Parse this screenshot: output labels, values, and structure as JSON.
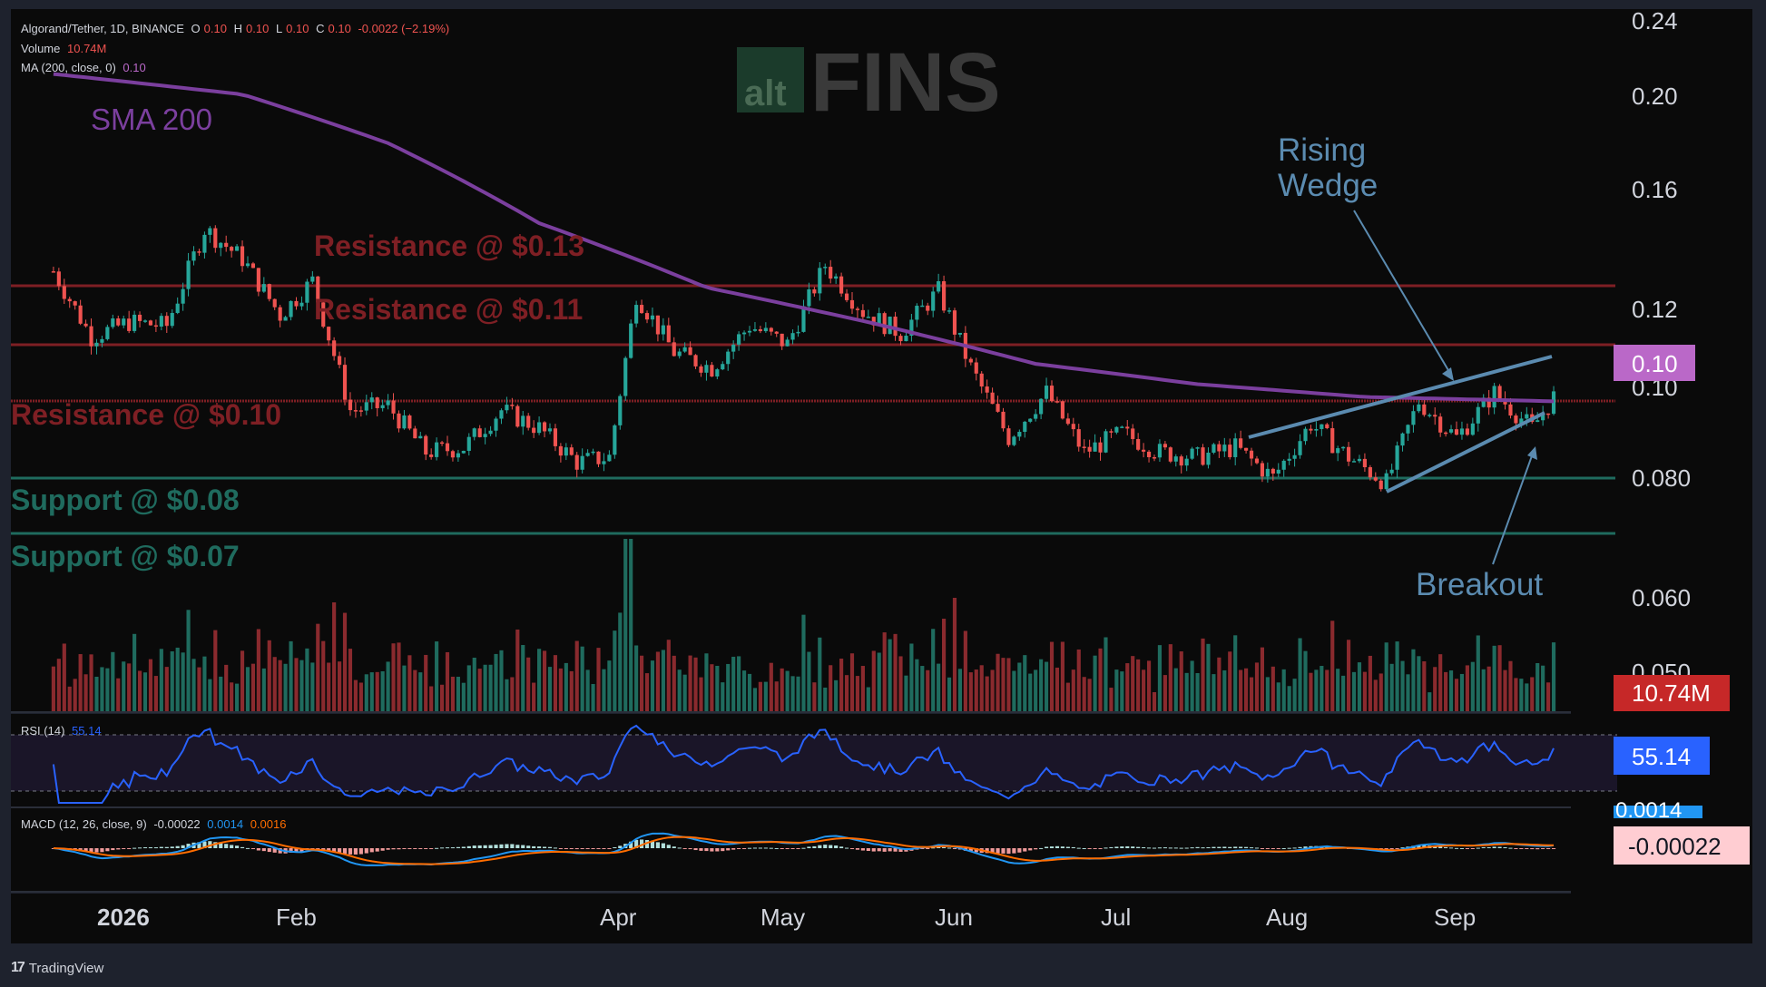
{
  "legend": {
    "symbol": "Algorand/Tether, 1D, BINANCE",
    "o_label": "O",
    "o_value": "0.10",
    "h_label": "H",
    "h_value": "0.10",
    "l_label": "L",
    "l_value": "0.10",
    "c_label": "C",
    "c_value": "0.10",
    "change": "-0.0022 (−2.19%)",
    "volume_label": "Volume",
    "volume_value": "10.74M",
    "ma_label": "MA (200, close, 0)",
    "ma_value": "0.10"
  },
  "watermark": {
    "alt": "alt",
    "fins": "FINS"
  },
  "annotations": {
    "sma": "SMA 200",
    "res13": "Resistance @ $0.13",
    "res11": "Resistance @ $0.11",
    "res10": "Resistance @ $0.10",
    "sup08": "Support @ $0.08",
    "sup07": "Support @ $0.07",
    "wedge1": "Rising",
    "wedge2": "Wedge",
    "breakout": "Breakout"
  },
  "price_axis": {
    "ticks": [
      "0.24",
      "0.20",
      "0.16",
      "0.12",
      "0.10",
      "0.080",
      "0.060",
      "0.050"
    ],
    "price_tag": "0.10",
    "volume_tag": "10.74M"
  },
  "rsi": {
    "label": "RSI (14)",
    "value": "55.14",
    "tag": "55.14"
  },
  "macd": {
    "label": "MACD (12, 26, close, 9)",
    "v1": "-0.00022",
    "v2": "0.0014",
    "v3": "0.0016",
    "tag_top": "0.0014",
    "tag": "-0.00022"
  },
  "time_axis": [
    "2026",
    "Feb",
    "Apr",
    "May",
    "Jun",
    "Jul",
    "Aug",
    "Sep"
  ],
  "branding": "TradingView",
  "colors": {
    "up": "#26a69a",
    "down": "#ef5350",
    "sma": "#7b3f9e",
    "resistance": "#7e1f24",
    "support": "#1f6b5e",
    "wedge": "#5b8bb0",
    "rsi": "#2962ff",
    "macd": "#2196f3",
    "signal": "#ff6d00"
  },
  "chart_data": {
    "type": "candlestick",
    "title": "Algorand/Tether, 1D, BINANCE",
    "y_scale": "log",
    "ylim": [
      0.05,
      0.24
    ],
    "x_range": [
      "2025-12-15",
      "2026-09-25"
    ],
    "levels": [
      {
        "name": "Resistance @ $0.13",
        "value": 0.125
      },
      {
        "name": "Resistance @ $0.11",
        "value": 0.108
      },
      {
        "name": "Resistance @ $0.10",
        "value": 0.096
      },
      {
        "name": "Support @ $0.08",
        "value": 0.08
      },
      {
        "name": "Support @ $0.07",
        "value": 0.07
      }
    ],
    "close_path": [
      {
        "date": "2025-12-15",
        "close": 0.131
      },
      {
        "date": "2025-12-22",
        "close": 0.112
      },
      {
        "date": "2025-12-29",
        "close": 0.116
      },
      {
        "date": "2026-01-05",
        "close": 0.115
      },
      {
        "date": "2026-01-12",
        "close": 0.145
      },
      {
        "date": "2026-01-19",
        "close": 0.135
      },
      {
        "date": "2026-01-26",
        "close": 0.118
      },
      {
        "date": "2026-02-01",
        "close": 0.128
      },
      {
        "date": "2026-02-08",
        "close": 0.094
      },
      {
        "date": "2026-02-15",
        "close": 0.095
      },
      {
        "date": "2026-02-22",
        "close": 0.085
      },
      {
        "date": "2026-03-01",
        "close": 0.086
      },
      {
        "date": "2026-03-08",
        "close": 0.094
      },
      {
        "date": "2026-03-15",
        "close": 0.09
      },
      {
        "date": "2026-03-22",
        "close": 0.083
      },
      {
        "date": "2026-03-28",
        "close": 0.084
      },
      {
        "date": "2026-04-02",
        "close": 0.124
      },
      {
        "date": "2026-04-09",
        "close": 0.108
      },
      {
        "date": "2026-04-16",
        "close": 0.104
      },
      {
        "date": "2026-04-23",
        "close": 0.115
      },
      {
        "date": "2026-04-30",
        "close": 0.11
      },
      {
        "date": "2026-05-07",
        "close": 0.133
      },
      {
        "date": "2026-05-14",
        "close": 0.119
      },
      {
        "date": "2026-05-21",
        "close": 0.113
      },
      {
        "date": "2026-05-28",
        "close": 0.125
      },
      {
        "date": "2026-06-03",
        "close": 0.104
      },
      {
        "date": "2026-06-10",
        "close": 0.088
      },
      {
        "date": "2026-06-17",
        "close": 0.098
      },
      {
        "date": "2026-06-24",
        "close": 0.085
      },
      {
        "date": "2026-07-01",
        "close": 0.089
      },
      {
        "date": "2026-07-08",
        "close": 0.085
      },
      {
        "date": "2026-07-15",
        "close": 0.084
      },
      {
        "date": "2026-07-22",
        "close": 0.086
      },
      {
        "date": "2026-07-29",
        "close": 0.08
      },
      {
        "date": "2026-08-05",
        "close": 0.091
      },
      {
        "date": "2026-08-12",
        "close": 0.084
      },
      {
        "date": "2026-08-19",
        "close": 0.079
      },
      {
        "date": "2026-08-25",
        "close": 0.096
      },
      {
        "date": "2026-09-01",
        "close": 0.088
      },
      {
        "date": "2026-09-08",
        "close": 0.098
      },
      {
        "date": "2026-09-15",
        "close": 0.09
      },
      {
        "date": "2026-09-19",
        "close": 0.097
      }
    ],
    "sma200_path": [
      {
        "date": "2025-12-15",
        "value": 0.21
      },
      {
        "date": "2026-01-19",
        "value": 0.2
      },
      {
        "date": "2026-02-15",
        "value": 0.178
      },
      {
        "date": "2026-03-15",
        "value": 0.147
      },
      {
        "date": "2026-04-15",
        "value": 0.126
      },
      {
        "date": "2026-05-15",
        "value": 0.116
      },
      {
        "date": "2026-06-15",
        "value": 0.105
      },
      {
        "date": "2026-07-15",
        "value": 0.1
      },
      {
        "date": "2026-08-15",
        "value": 0.097
      },
      {
        "date": "2026-09-19",
        "value": 0.096
      }
    ],
    "wedge": {
      "upper": [
        {
          "date": "2026-07-27",
          "value": 0.088
        },
        {
          "date": "2026-09-20",
          "value": 0.104
        }
      ],
      "lower": [
        {
          "date": "2026-08-19",
          "value": 0.078
        },
        {
          "date": "2026-09-18",
          "value": 0.092
        }
      ]
    },
    "rsi_value": 55.14,
    "macd_value": -0.00022,
    "signal_value": 0.0014,
    "histogram_value": 0.0016,
    "last_volume": "10.74M"
  }
}
